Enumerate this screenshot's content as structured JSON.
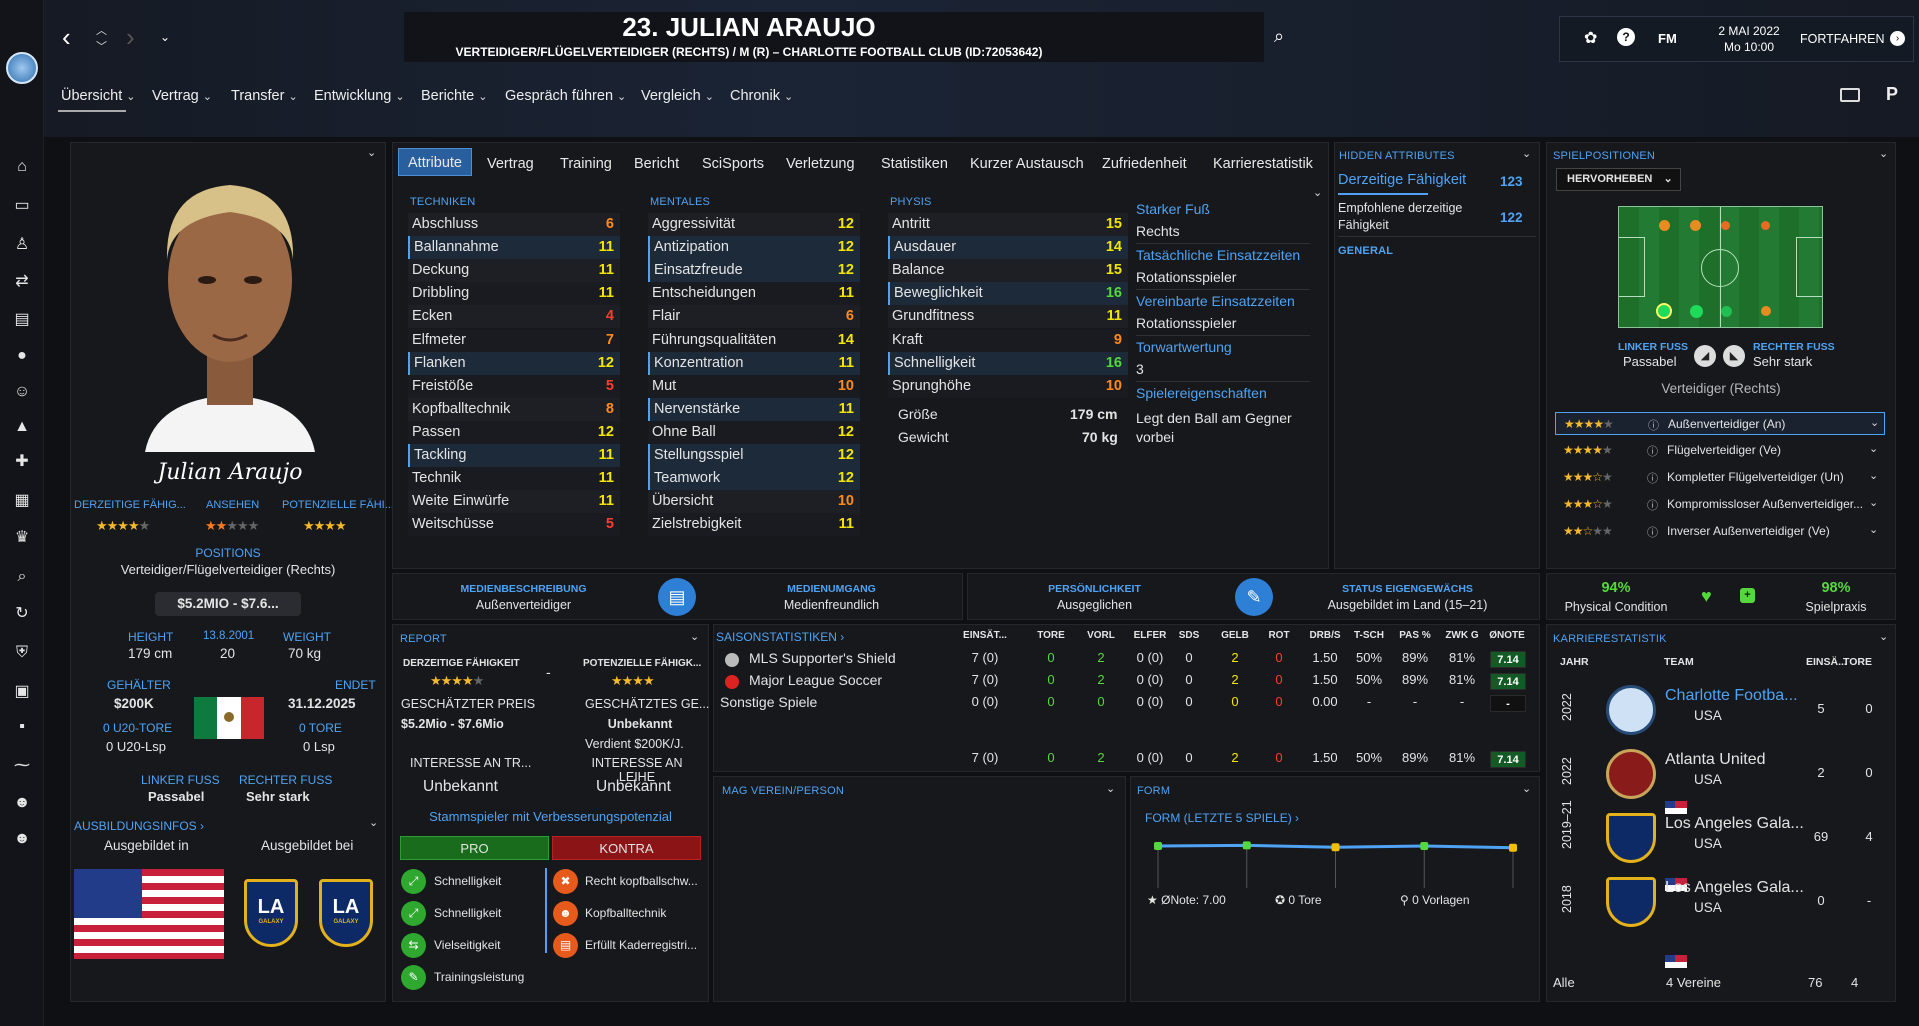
{
  "header": {
    "title": "23. JULIAN ARAUJO",
    "subtitle": "VERTEIDIGER/FLÜGELVERTEIDIGER (RECHTS) / M (R) – CHARLOTTE FOOTBALL CLUB (ID:72053642)",
    "date": "2 MAI 2022",
    "time": "Mo 10:00",
    "continue": "FORTFAHREN",
    "fm": "FM"
  },
  "nav": [
    "Übersicht",
    "Vertrag",
    "Transfer",
    "Entwicklung",
    "Berichte",
    "Gespräch führen",
    "Vergleich",
    "Chronik"
  ],
  "profile": {
    "signature": "Julian Araujo",
    "labels": {
      "ca": "DERZEITIGE FÄHIG...",
      "rep": "ANSEHEN",
      "pa": "POTENZIELLE FÄHI..."
    },
    "positions_label": "POSITIONS",
    "positions": "Verteidiger/Flügelverteidiger (Rechts)",
    "value": "$5.2MIO - $7.6...",
    "height_label": "HEIGHT",
    "height": "179 cm",
    "dob": "13.8.2001",
    "age": "20",
    "weight_label": "WEIGHT",
    "weight": "70 kg",
    "salary_label": "GEHÄLTER",
    "salary": "$200K",
    "ends_label": "ENDET",
    "ends": "31.12.2025",
    "u20_goals_label": "0 U20-TORE",
    "u20_games": "0 U20-Lsp",
    "goals_label": "0 TORE",
    "games": "0 Lsp",
    "left_foot_label": "LINKER FUSS",
    "left_foot": "Passabel",
    "right_foot_label": "RECHTER FUSS",
    "right_foot": "Sehr stark",
    "training_label": "AUSBILDUNGSINFOS",
    "trained_in": "Ausgebildet in",
    "trained_at": "Ausgebildet bei",
    "la": "LA",
    "galaxy": "GALAXY"
  },
  "tabs": [
    "Attribute",
    "Vertrag",
    "Training",
    "Bericht",
    "SciSports",
    "Verletzung",
    "Statistiken",
    "Kurzer Austausch",
    "Zufriedenheit",
    "Karrierestatistik"
  ],
  "attributes": {
    "tech_label": "TECHNIKEN",
    "ment_label": "MENTALES",
    "phys_label": "PHYSIS",
    "technical": [
      {
        "n": "Abschluss",
        "v": "6",
        "c": "orange"
      },
      {
        "n": "Ballannahme",
        "v": "11",
        "c": "yellow"
      },
      {
        "n": "Deckung",
        "v": "11",
        "c": "yellow"
      },
      {
        "n": "Dribbling",
        "v": "11",
        "c": "yellow"
      },
      {
        "n": "Ecken",
        "v": "4",
        "c": "red"
      },
      {
        "n": "Elfmeter",
        "v": "7",
        "c": "orange"
      },
      {
        "n": "Flanken",
        "v": "12",
        "c": "yellow"
      },
      {
        "n": "Freistöße",
        "v": "5",
        "c": "red"
      },
      {
        "n": "Kopfballtechnik",
        "v": "8",
        "c": "orange"
      },
      {
        "n": "Passen",
        "v": "12",
        "c": "yellow"
      },
      {
        "n": "Tackling",
        "v": "11",
        "c": "yellow"
      },
      {
        "n": "Technik",
        "v": "11",
        "c": "yellow"
      },
      {
        "n": "Weite Einwürfe",
        "v": "11",
        "c": "yellow"
      },
      {
        "n": "Weitschüsse",
        "v": "5",
        "c": "red"
      }
    ],
    "mental": [
      {
        "n": "Aggressivität",
        "v": "12",
        "c": "yellow"
      },
      {
        "n": "Antizipation",
        "v": "12",
        "c": "yellow"
      },
      {
        "n": "Einsatzfreude",
        "v": "12",
        "c": "yellow"
      },
      {
        "n": "Entscheidungen",
        "v": "11",
        "c": "yellow"
      },
      {
        "n": "Flair",
        "v": "6",
        "c": "orange"
      },
      {
        "n": "Führungsqualitäten",
        "v": "14",
        "c": "yellow"
      },
      {
        "n": "Konzentration",
        "v": "11",
        "c": "yellow"
      },
      {
        "n": "Mut",
        "v": "10",
        "c": "orange"
      },
      {
        "n": "Nervenstärke",
        "v": "11",
        "c": "yellow"
      },
      {
        "n": "Ohne Ball",
        "v": "12",
        "c": "yellow"
      },
      {
        "n": "Stellungsspiel",
        "v": "12",
        "c": "yellow"
      },
      {
        "n": "Teamwork",
        "v": "12",
        "c": "yellow"
      },
      {
        "n": "Übersicht",
        "v": "10",
        "c": "orange"
      },
      {
        "n": "Zielstrebigkeit",
        "v": "11",
        "c": "yellow"
      }
    ],
    "physical": [
      {
        "n": "Antritt",
        "v": "15",
        "c": "yellow"
      },
      {
        "n": "Ausdauer",
        "v": "14",
        "c": "yellow"
      },
      {
        "n": "Balance",
        "v": "15",
        "c": "yellow"
      },
      {
        "n": "Beweglichkeit",
        "v": "16",
        "c": "green"
      },
      {
        "n": "Grundfitness",
        "v": "11",
        "c": "yellow"
      },
      {
        "n": "Kraft",
        "v": "9",
        "c": "orange"
      },
      {
        "n": "Schnelligkeit",
        "v": "16",
        "c": "green"
      },
      {
        "n": "Sprunghöhe",
        "v": "10",
        "c": "orange"
      }
    ],
    "size_label": "Größe",
    "size": "179 cm",
    "weight_label": "Gewicht",
    "weight": "70 kg"
  },
  "info": {
    "foot_label": "Starker Fuß",
    "foot": "Rechts",
    "actual_label": "Tatsächliche Einsatzzeiten",
    "actual": "Rotationsspieler",
    "agreed_label": "Vereinbarte Einsatzzeiten",
    "agreed": "Rotationsspieler",
    "expect_label": "Torwartwertung",
    "expect": "3",
    "traits_label": "Spielereigenschaften",
    "traits": "Legt den Ball am Gegner vorbei"
  },
  "hidden": {
    "title": "HIDDEN ATTRIBUTES",
    "ca_label": "Derzeitige Fähigkeit",
    "ca": "123",
    "rec_label": "Empfohlene derzeitige Fähigkeit",
    "rec": "122",
    "general": "GENERAL"
  },
  "positions": {
    "title": "SPIELPOSITIONEN",
    "highlight": "HERVORHEBEN",
    "left_foot_label": "LINKER FUSS",
    "left_foot": "Passabel",
    "right_foot_label": "RECHTER FUSS",
    "right_foot": "Sehr stark",
    "role": "Verteidiger (Rechts)",
    "roles": [
      "Außenverteidiger (An)",
      "Flügelverteidiger (Ve)",
      "Kompletter Flügelverteidiger (Un)",
      "Kompromissloser Außenverteidiger...",
      "Inverser Außenverteidiger (Ve)"
    ]
  },
  "media": {
    "desc_label": "MEDIENBESCHREIBUNG",
    "desc": "Außenverteidiger",
    "handling_label": "MEDIENUMGANG",
    "handling": "Medienfreundlich",
    "pers_label": "PERSÖNLICHKEIT",
    "pers": "Ausgeglichen",
    "status_label": "STATUS EIGENGEWÄCHS",
    "status": "Ausgebildet im Land (15–21)"
  },
  "condition": {
    "cond": "94%",
    "cond_label": "Physical Condition",
    "prac": "98%",
    "prac_label": "Spielpraxis"
  },
  "report": {
    "title": "REPORT",
    "ca_label": "DERZEITIGE FÄHIGKEIT",
    "pa_label": "POTENZIELLE FÄHIGK...",
    "dash": "-",
    "price_label": "GESCHÄTZTER PREIS",
    "price": "$5.2Mio - $7.6Mio",
    "salary_label": "GESCHÄTZTES GE...",
    "salary": "Unbekannt",
    "earns": "Verdient $200K/J.",
    "int_transfer_label": "INTERESSE AN TR...",
    "int_transfer": "Unbekannt",
    "int_loan_label": "INTERESSE AN LEIHE",
    "int_loan": "Unbekannt",
    "summary": "Stammspieler mit Verbesserungspotenzial",
    "pro": "PRO",
    "contra": "KONTRA",
    "pros": [
      "Schnelligkeit",
      "Schnelligkeit",
      "Vielseitigkeit",
      "Trainingsleistung"
    ],
    "cons": [
      "Recht kopfballschw...",
      "Kopfballtechnik",
      "Erfüllt Kaderregistri..."
    ]
  },
  "season": {
    "title": "SAISONSTATISTIKEN",
    "cols": [
      "EINSÄT...",
      "TORE",
      "VORL",
      "ELFER",
      "SDS",
      "GELB",
      "ROT",
      "DRB/S",
      "T-SCH",
      "PAS %",
      "ZWK G",
      "ØNOTE"
    ],
    "rows": [
      {
        "name": "MLS Supporter's Shield",
        "v": [
          "7 (0)",
          "0",
          "2",
          "0 (0)",
          "0",
          "2",
          "0",
          "1.50",
          "50%",
          "89%",
          "81%",
          "7.14"
        ]
      },
      {
        "name": "Major League Soccer",
        "v": [
          "7 (0)",
          "0",
          "2",
          "0 (0)",
          "0",
          "2",
          "0",
          "1.50",
          "50%",
          "89%",
          "81%",
          "7.14"
        ]
      },
      {
        "name": "Sonstige Spiele",
        "v": [
          "0 (0)",
          "0",
          "0",
          "0 (0)",
          "0",
          "0",
          "0",
          "0.00",
          "-",
          "-",
          "-",
          "-"
        ]
      }
    ],
    "total": [
      "7 (0)",
      "0",
      "2",
      "0 (0)",
      "0",
      "2",
      "0",
      "1.50",
      "50%",
      "89%",
      "81%",
      "7.14"
    ]
  },
  "mag": {
    "title": "MAG VEREIN/PERSON"
  },
  "form": {
    "title": "FORM",
    "sub": "FORM (LETZTE 5 SPIELE)",
    "avg": "ØNote: 7.00",
    "goals": "0 Tore",
    "assists": "0 Vorlagen"
  },
  "career": {
    "title": "KARRIERESTATISTIK",
    "cols": [
      "JAHR",
      "TEAM",
      "EINSÄ...",
      "TORE"
    ],
    "rows": [
      {
        "year": "2022",
        "team": "Charlotte Footba...",
        "country": "USA",
        "apps": "5",
        "goals": "0",
        "crest": "CHARLOTTE"
      },
      {
        "year": "2022",
        "team": "Atlanta United",
        "country": "USA",
        "apps": "2",
        "goals": "0",
        "crest": "ATLANTA"
      },
      {
        "year": "2019–21",
        "team": "Los Angeles Gala...",
        "country": "USA",
        "apps": "69",
        "goals": "4",
        "crest": "LA"
      },
      {
        "year": "2018",
        "team": "Los Angeles Gala...",
        "country": "USA",
        "apps": "0",
        "goals": "-",
        "crest": "LA"
      }
    ],
    "all_label": "Alle",
    "clubs": "4 Vereine",
    "total_apps": "76",
    "total_goals": "4"
  },
  "chart_data": {
    "type": "line",
    "series": [
      {
        "values": [
          7.0,
          7.1,
          6.8,
          7.0,
          6.7
        ]
      }
    ]
  }
}
